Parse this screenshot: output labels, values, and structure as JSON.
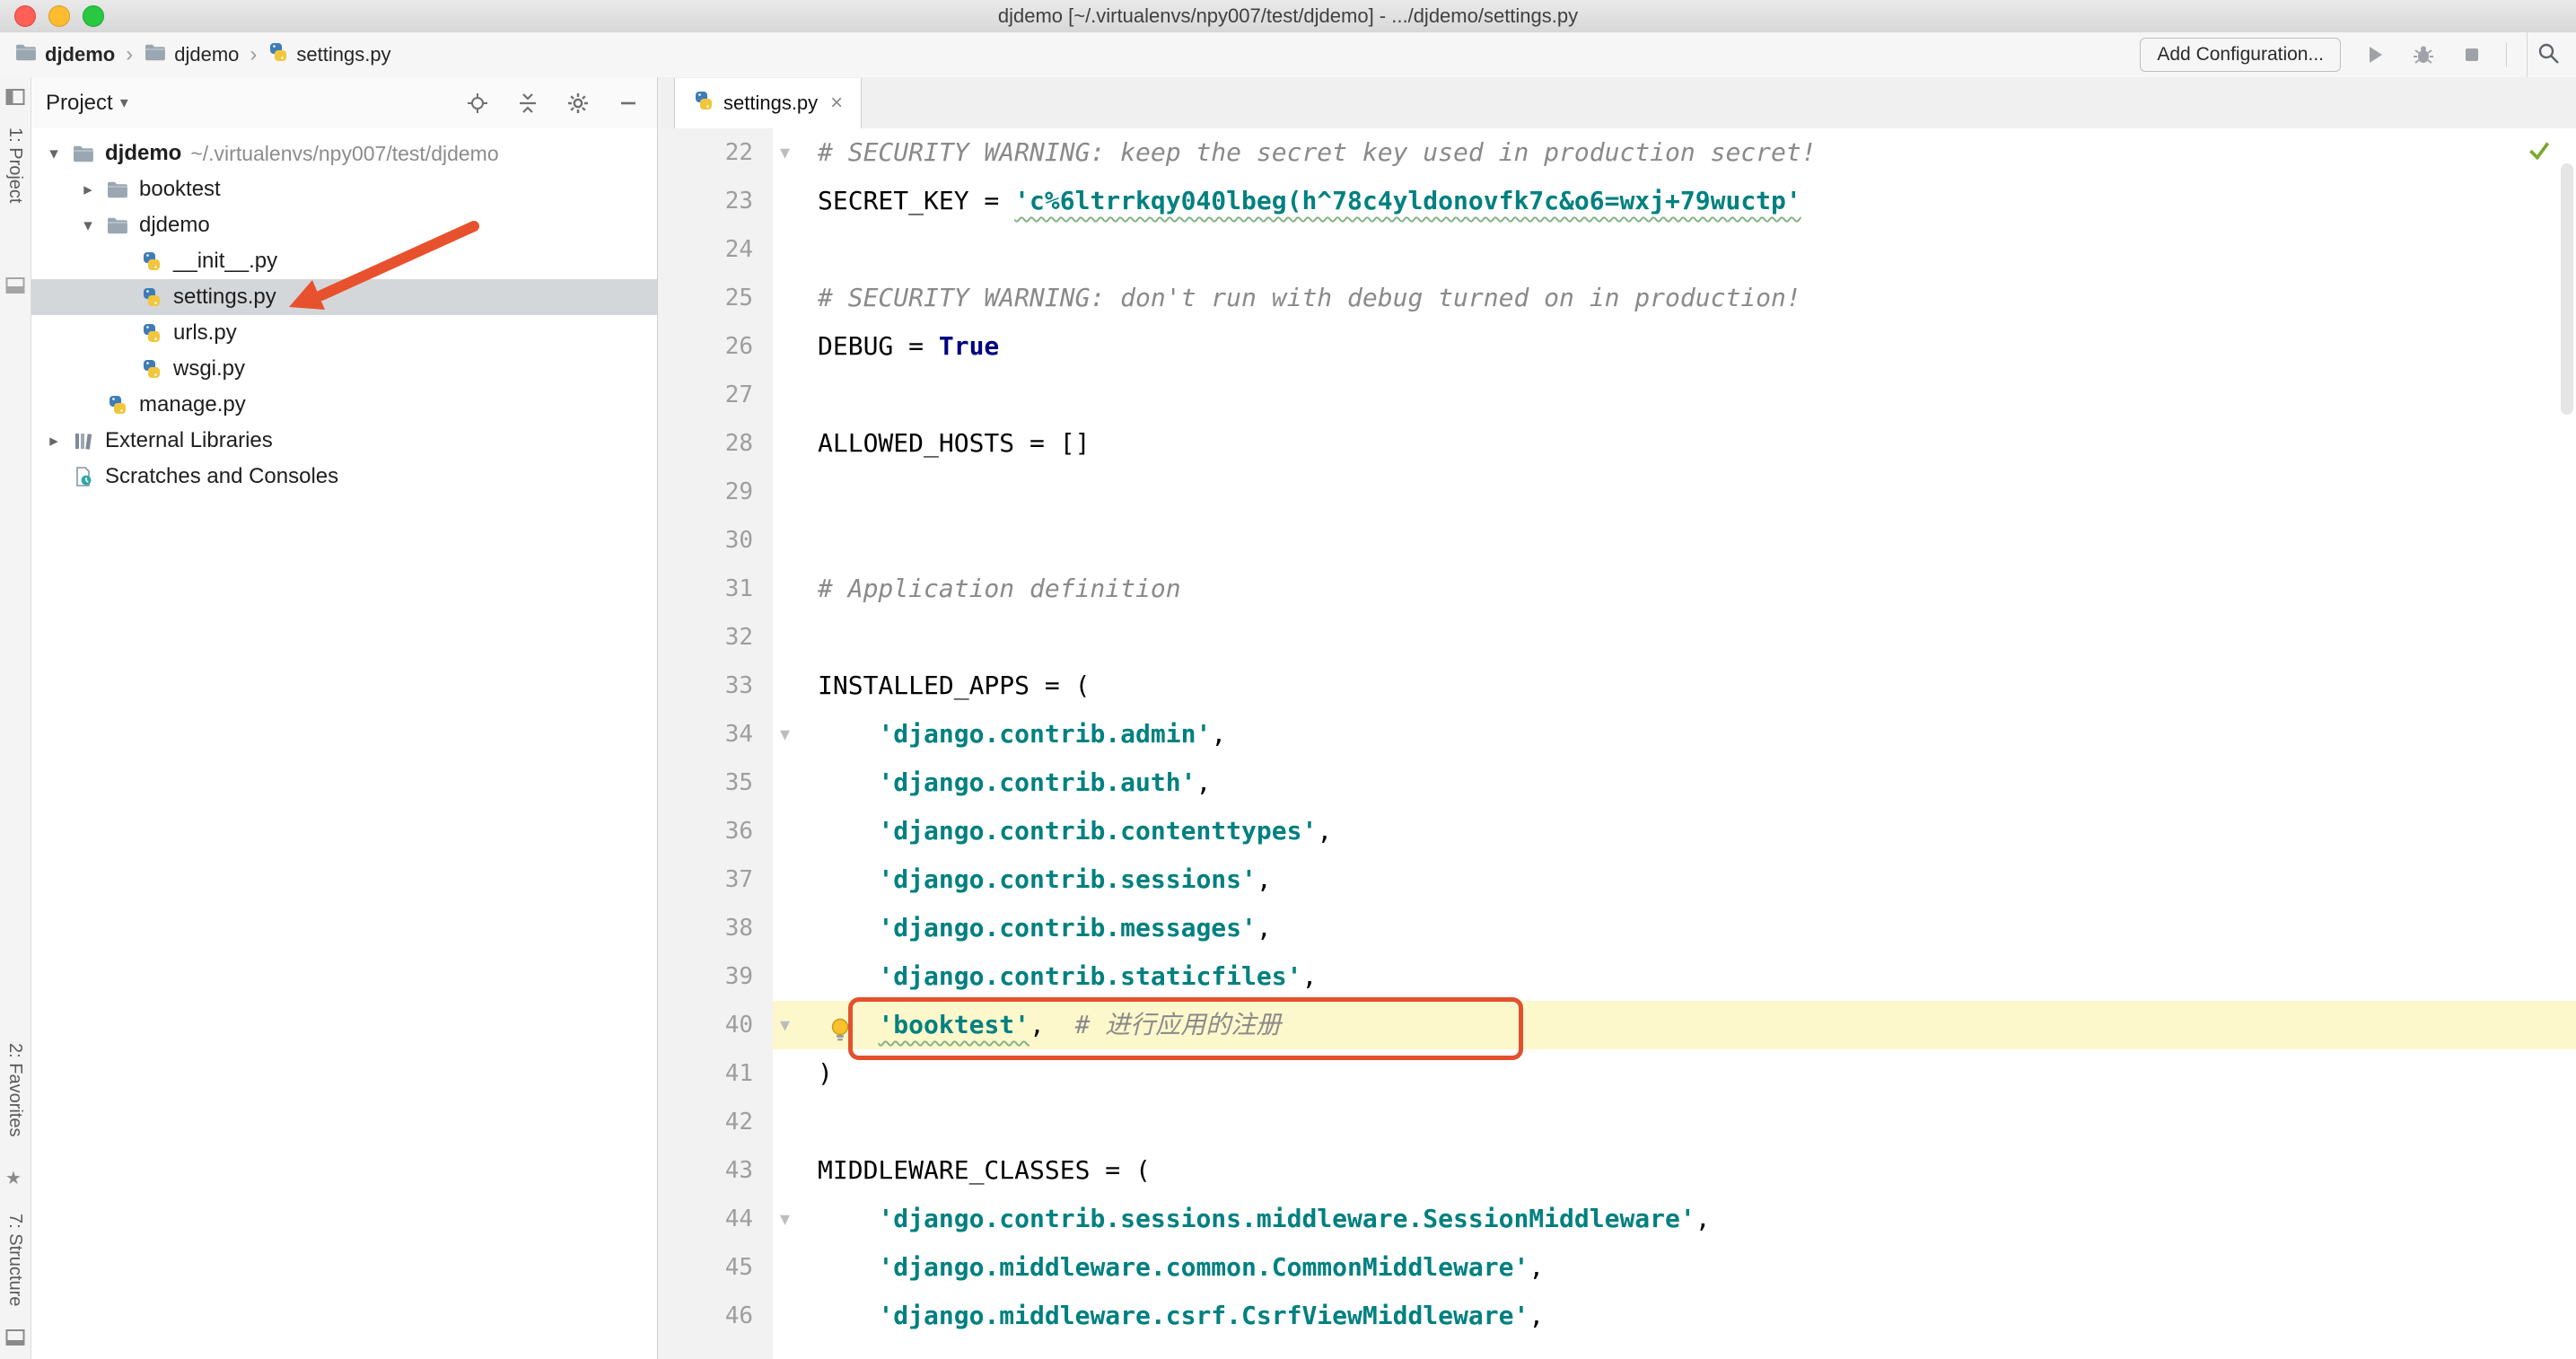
{
  "window": {
    "title": "djdemo [~/.virtualenvs/npy007/test/djdemo] - .../djdemo/settings.py"
  },
  "toolbar": {
    "breadcrumbs": [
      {
        "label": "djdemo",
        "icon": "folder",
        "bold": true
      },
      {
        "label": "djdemo",
        "icon": "folder",
        "bold": false
      },
      {
        "label": "settings.py",
        "icon": "python",
        "bold": false
      }
    ],
    "add_configuration_label": "Add Configuration..."
  },
  "left_stripe": {
    "project": "1: Project",
    "favorites": "2: Favorites",
    "structure": "7: Structure"
  },
  "project_panel": {
    "title": "Project",
    "tree": [
      {
        "label": "djdemo",
        "path": "~/.virtualenvs/npy007/test/djdemo",
        "icon": "folder",
        "depth": 0,
        "chevron": "expanded",
        "bold": true
      },
      {
        "label": "booktest",
        "icon": "folder",
        "depth": 1,
        "chevron": "collapsed"
      },
      {
        "label": "djdemo",
        "icon": "folder",
        "depth": 1,
        "chevron": "expanded"
      },
      {
        "label": "__init__.py",
        "icon": "python",
        "depth": 2
      },
      {
        "label": "settings.py",
        "icon": "python",
        "depth": 2,
        "selected": true
      },
      {
        "label": "urls.py",
        "icon": "python",
        "depth": 2
      },
      {
        "label": "wsgi.py",
        "icon": "python",
        "depth": 2
      },
      {
        "label": "manage.py",
        "icon": "python",
        "depth": 1
      },
      {
        "label": "External Libraries",
        "icon": "libraries",
        "depth": 0,
        "chevron": "collapsed"
      },
      {
        "label": "Scratches and Consoles",
        "icon": "scratches",
        "depth": 0
      }
    ]
  },
  "editor": {
    "tab": {
      "label": "settings.py"
    },
    "lines": [
      {
        "n": 22,
        "fold": true,
        "tokens": [
          [
            "comment",
            "# SECURITY WARNING: keep the secret key used in production secret!"
          ]
        ]
      },
      {
        "n": 23,
        "tokens": [
          [
            "plain",
            "SECRET_KEY = "
          ],
          [
            "string-typo",
            "'c%6ltrrkqy040lbeg(h^78c4yldonovfk7c&o6=wxj+79wuctp'"
          ]
        ]
      },
      {
        "n": 24,
        "tokens": []
      },
      {
        "n": 25,
        "tokens": [
          [
            "comment",
            "# SECURITY WARNING: don't run with debug turned on in production!"
          ]
        ]
      },
      {
        "n": 26,
        "tokens": [
          [
            "plain",
            "DEBUG = "
          ],
          [
            "keyword",
            "True"
          ]
        ]
      },
      {
        "n": 27,
        "tokens": []
      },
      {
        "n": 28,
        "tokens": [
          [
            "plain",
            "ALLOWED_HOSTS = []"
          ]
        ]
      },
      {
        "n": 29,
        "tokens": []
      },
      {
        "n": 30,
        "tokens": []
      },
      {
        "n": 31,
        "tokens": [
          [
            "comment",
            "# Application definition"
          ]
        ]
      },
      {
        "n": 32,
        "tokens": []
      },
      {
        "n": 33,
        "tokens": [
          [
            "plain",
            "INSTALLED_APPS = ("
          ]
        ]
      },
      {
        "n": 34,
        "fold": true,
        "tokens": [
          [
            "plain",
            "    "
          ],
          [
            "string",
            "'django.contrib.admin'"
          ],
          [
            "plain",
            ","
          ]
        ]
      },
      {
        "n": 35,
        "tokens": [
          [
            "plain",
            "    "
          ],
          [
            "string",
            "'django.contrib.auth'"
          ],
          [
            "plain",
            ","
          ]
        ]
      },
      {
        "n": 36,
        "tokens": [
          [
            "plain",
            "    "
          ],
          [
            "string",
            "'django.contrib.contenttypes'"
          ],
          [
            "plain",
            ","
          ]
        ]
      },
      {
        "n": 37,
        "tokens": [
          [
            "plain",
            "    "
          ],
          [
            "string",
            "'django.contrib.sessions'"
          ],
          [
            "plain",
            ","
          ]
        ]
      },
      {
        "n": 38,
        "tokens": [
          [
            "plain",
            "    "
          ],
          [
            "string",
            "'django.contrib.messages'"
          ],
          [
            "plain",
            ","
          ]
        ]
      },
      {
        "n": 39,
        "tokens": [
          [
            "plain",
            "    "
          ],
          [
            "string",
            "'django.contrib.staticfiles'"
          ],
          [
            "plain",
            ","
          ]
        ]
      },
      {
        "n": 40,
        "fold": true,
        "bulb": true,
        "highlight": true,
        "box": true,
        "tokens": [
          [
            "plain",
            "    "
          ],
          [
            "string-typo",
            "'booktest'"
          ],
          [
            "plain",
            ",  "
          ],
          [
            "comment",
            "# 进行应用的注册"
          ]
        ]
      },
      {
        "n": 41,
        "tokens": [
          [
            "plain",
            ")"
          ]
        ]
      },
      {
        "n": 42,
        "tokens": []
      },
      {
        "n": 43,
        "tokens": [
          [
            "plain",
            "MIDDLEWARE_CLASSES = ("
          ]
        ]
      },
      {
        "n": 44,
        "fold": true,
        "tokens": [
          [
            "plain",
            "    "
          ],
          [
            "string",
            "'django.contrib.sessions.middleware.SessionMiddleware'"
          ],
          [
            "plain",
            ","
          ]
        ]
      },
      {
        "n": 45,
        "tokens": [
          [
            "plain",
            "    "
          ],
          [
            "string",
            "'django.middleware.common.CommonMiddleware'"
          ],
          [
            "plain",
            ","
          ]
        ]
      },
      {
        "n": 46,
        "tokens": [
          [
            "plain",
            "    "
          ],
          [
            "string",
            "'django.middleware.csrf.CsrfViewMiddleware'"
          ],
          [
            "plain",
            ","
          ]
        ]
      }
    ]
  },
  "icons": {
    "dropdown_caret": "▾",
    "chevron_expanded": "▾",
    "chevron_collapsed": "▸",
    "breadcrumb_separator": "›",
    "close": "×",
    "star": "★",
    "line_fold": "▾"
  },
  "colors": {
    "string": "#008080",
    "keyword": "#000080",
    "comment": "#8a8a8a",
    "current_line": "#fdf8cc",
    "annotation": "#e4502e",
    "selection": "#d4d7da"
  }
}
